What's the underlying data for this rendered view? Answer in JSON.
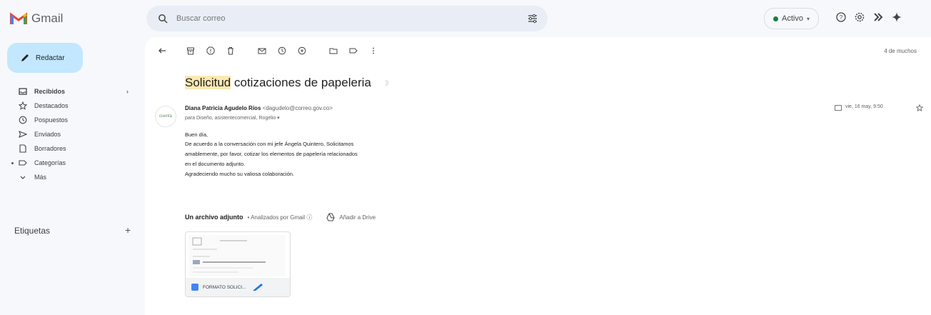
{
  "app": {
    "name": "Gmail"
  },
  "top_bar": {
    "search_placeholder": "Buscar correo",
    "status_label": "Activo",
    "icons": [
      "help-icon",
      "settings-icon",
      "apps-icon",
      "gemini-icon"
    ]
  },
  "sidebar": {
    "compose_label": "Redactar",
    "items": [
      {
        "label": "Recibidos",
        "icon": "inbox-icon",
        "bold": true
      },
      {
        "label": "Destacados",
        "icon": "star-icon"
      },
      {
        "label": "Pospuestos",
        "icon": "clock-icon"
      },
      {
        "label": "Enviados",
        "icon": "send-icon"
      },
      {
        "label": "Borradores",
        "icon": "draft-icon"
      },
      {
        "label": "Categorías",
        "icon": "label-icon"
      },
      {
        "label": "Más",
        "icon": "chevron-down-icon"
      }
    ],
    "labels_header": "Etiquetas",
    "labels_add": "+"
  },
  "toolbar": {
    "pager": "4 de muchos"
  },
  "email": {
    "subject_highlight": "Solicitud",
    "subject_rest": " cotizaciones de papeleria",
    "avatar_text": "cuenta",
    "sender_name": "Diana Patricia Agudelo Ríos",
    "sender_email": "<dagudelo@correo.gov.co>",
    "recipients": "para Diseño, asistentecomercial, Rogelio ▾",
    "date": "vie, 16 may, 9:50",
    "body": [
      "Buen día,",
      "De acuerdo a la conversación con mi jefe Ángela Quintero, Solicitamos",
      "amablemente, por favor, cotizar los elementos de papelería relacionados",
      "en el documento adjunto.",
      "Agradeciendo mucho su valiosa colaboración."
    ]
  },
  "attachments": {
    "header_bold": "Un archivo adjunto",
    "scanned": "• Analizados por Gmail ⓘ",
    "add_to_drive": "Añadir a Drive",
    "file_name": "FORMATO SOLICI..."
  }
}
